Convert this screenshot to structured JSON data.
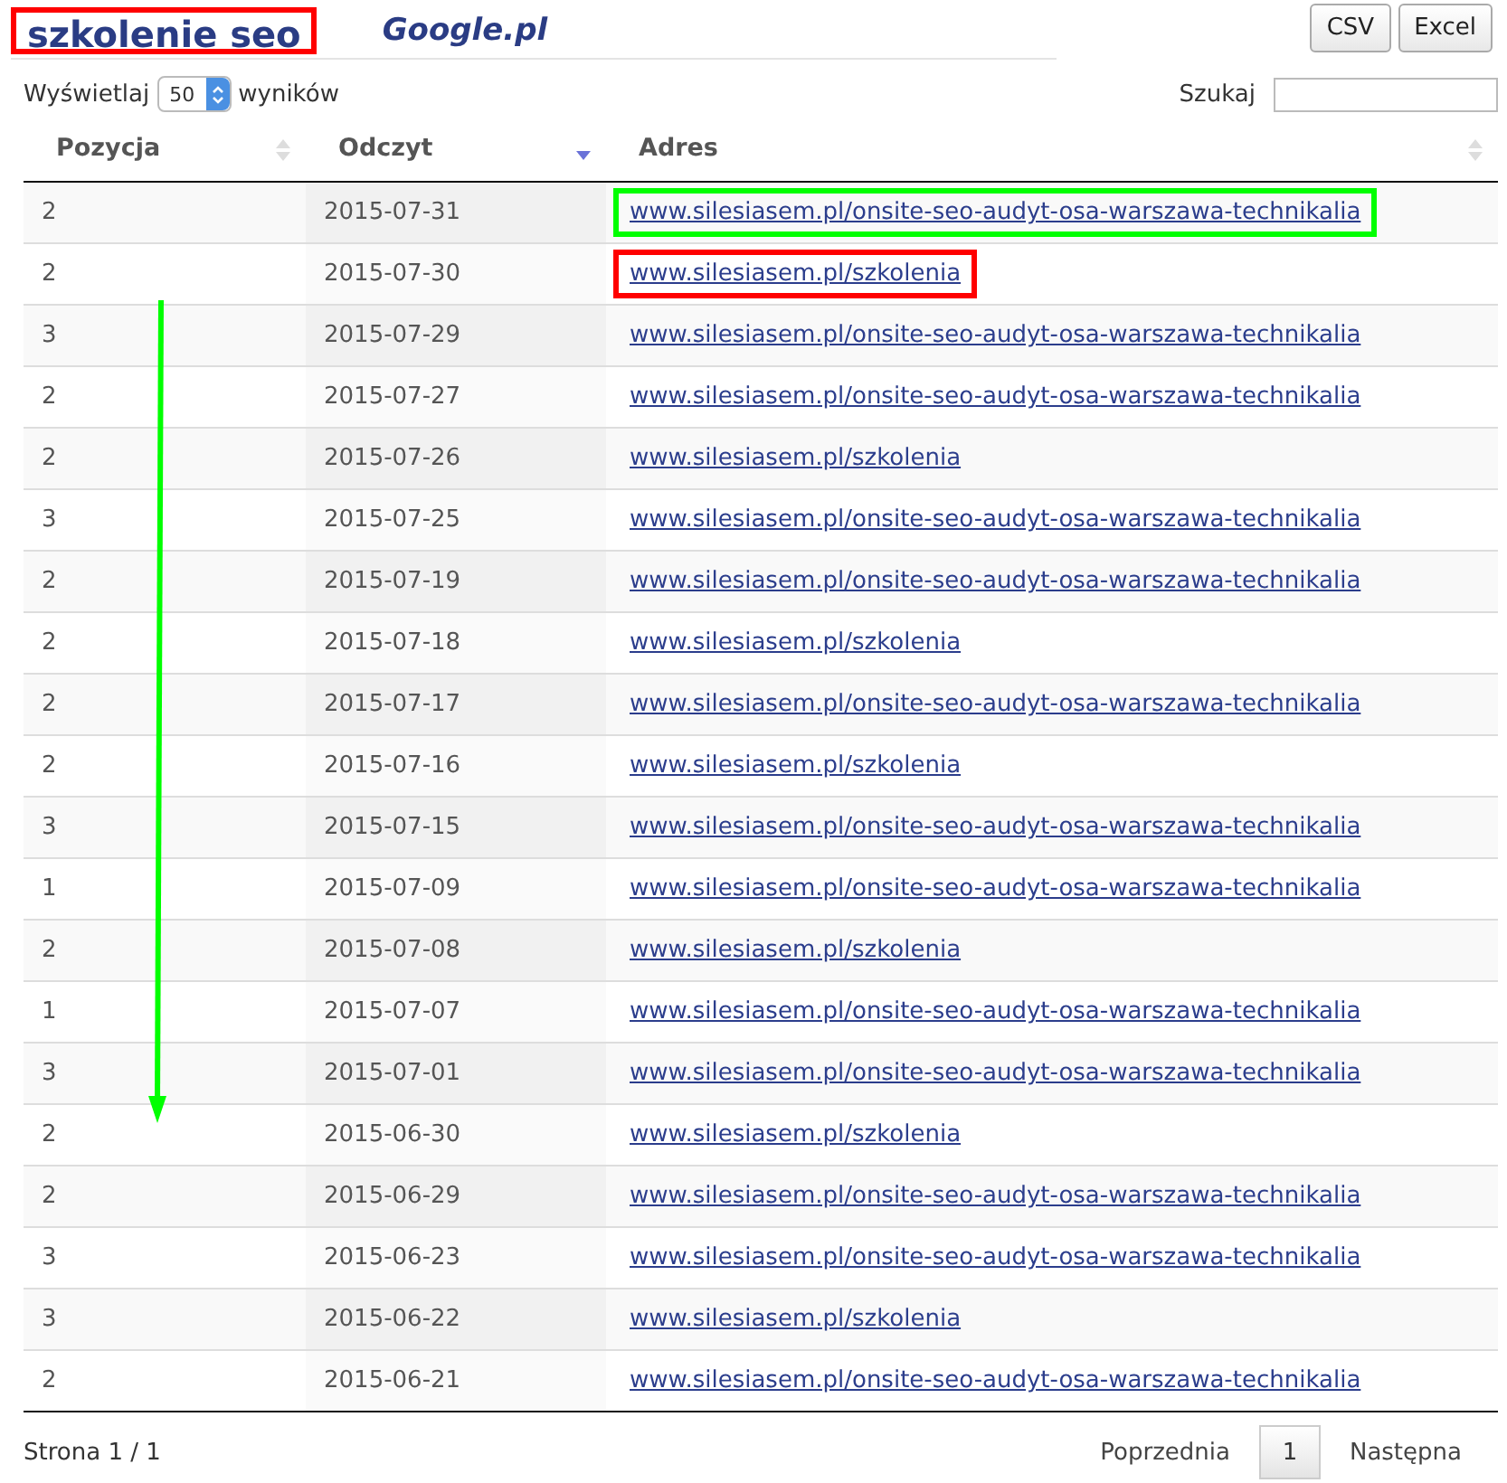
{
  "header": {
    "title": "szkolenie seo",
    "title_outlined": true,
    "engine": "Google.pl",
    "buttons": [
      "CSV",
      "Excel"
    ]
  },
  "controls": {
    "show_label": "Wyświetlaj",
    "page_size": "50",
    "show_suffix": "wyników",
    "search_label": "Szukaj"
  },
  "table": {
    "columns": [
      {
        "label": "Pozycja",
        "sorted": false
      },
      {
        "label": "Odczyt",
        "sorted": true
      },
      {
        "label": "Adres",
        "sorted": false
      }
    ],
    "rows": [
      {
        "cells": [
          "2",
          "2015-07-31",
          "www.silesiasem.pl/onsite-seo-audyt-osa-warszawa-technikalia"
        ],
        "color": "#00ff00"
      },
      {
        "cells": [
          "2",
          "2015-07-30",
          "www.silesiasem.pl/szkolenia"
        ],
        "color": "#ff0000"
      },
      {
        "cells": [
          "3",
          "2015-07-29",
          "www.silesiasem.pl/onsite-seo-audyt-osa-warszawa-technikalia"
        ]
      },
      {
        "cells": [
          "2",
          "2015-07-27",
          "www.silesiasem.pl/onsite-seo-audyt-osa-warszawa-technikalia"
        ]
      },
      {
        "cells": [
          "2",
          "2015-07-26",
          "www.silesiasem.pl/szkolenia"
        ]
      },
      {
        "cells": [
          "3",
          "2015-07-25",
          "www.silesiasem.pl/onsite-seo-audyt-osa-warszawa-technikalia"
        ]
      },
      {
        "cells": [
          "2",
          "2015-07-19",
          "www.silesiasem.pl/onsite-seo-audyt-osa-warszawa-technikalia"
        ]
      },
      {
        "cells": [
          "2",
          "2015-07-18",
          "www.silesiasem.pl/szkolenia"
        ]
      },
      {
        "cells": [
          "2",
          "2015-07-17",
          "www.silesiasem.pl/onsite-seo-audyt-osa-warszawa-technikalia"
        ]
      },
      {
        "cells": [
          "2",
          "2015-07-16",
          "www.silesiasem.pl/szkolenia"
        ]
      },
      {
        "cells": [
          "3",
          "2015-07-15",
          "www.silesiasem.pl/onsite-seo-audyt-osa-warszawa-technikalia"
        ]
      },
      {
        "cells": [
          "1",
          "2015-07-09",
          "www.silesiasem.pl/onsite-seo-audyt-osa-warszawa-technikalia"
        ]
      },
      {
        "cells": [
          "2",
          "2015-07-08",
          "www.silesiasem.pl/szkolenia"
        ]
      },
      {
        "cells": [
          "1",
          "2015-07-07",
          "www.silesiasem.pl/onsite-seo-audyt-osa-warszawa-technikalia"
        ]
      },
      {
        "cells": [
          "3",
          "2015-07-01",
          "www.silesiasem.pl/onsite-seo-audyt-osa-warszawa-technikalia"
        ]
      },
      {
        "cells": [
          "2",
          "2015-06-30",
          "www.silesiasem.pl/szkolenia"
        ]
      },
      {
        "cells": [
          "2",
          "2015-06-29",
          "www.silesiasem.pl/onsite-seo-audyt-osa-warszawa-technikalia"
        ]
      },
      {
        "cells": [
          "3",
          "2015-06-23",
          "www.silesiasem.pl/onsite-seo-audyt-osa-warszawa-technikalia"
        ]
      },
      {
        "cells": [
          "3",
          "2015-06-22",
          "www.silesiasem.pl/szkolenia"
        ]
      },
      {
        "cells": [
          "2",
          "2015-06-21",
          "www.silesiasem.pl/onsite-seo-audyt-osa-warszawa-technikalia"
        ]
      }
    ],
    "annotation": {
      "kind": "arrow",
      "color": "#00ff00"
    }
  },
  "footer": {
    "info": "Strona 1 / 1",
    "prev": "Poprzednia",
    "pages": [
      {
        "label": "1",
        "selected": true
      }
    ],
    "next": "Następna"
  }
}
